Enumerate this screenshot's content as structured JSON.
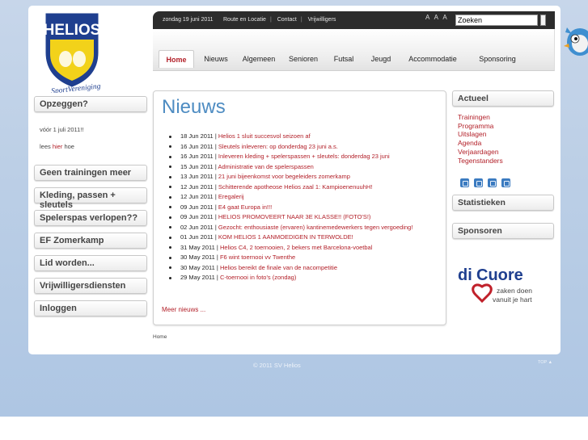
{
  "topbar": {
    "date": "zondag 19 juni 2011",
    "links": [
      "Route en Locatie",
      "Contact",
      "Vrijwilligers"
    ],
    "font_sizes": "A A A",
    "search_value": "Zoeken"
  },
  "logo": {
    "name": "HELIOS",
    "tagline": "SportVereniging"
  },
  "nav": {
    "tabs": [
      "Home",
      "Nieuws",
      "Algemeen",
      "Senioren",
      "Futsal",
      "Jeugd",
      "Accommodatie",
      "Sponsoring"
    ],
    "active": "Home"
  },
  "sidebar_left": {
    "opzeggen": {
      "title": "Opzeggen?",
      "text1": "vóór 1 juli 2011!!",
      "text2_prefix": "lees ",
      "text2_link": "hier",
      "text2_suffix": " hoe"
    },
    "items": [
      "Geen trainingen meer",
      "Kleding, passen + sleutels",
      "Spelerspas verlopen??",
      "EF Zomerkamp",
      "Lid worden...",
      "Vrijwilligersdiensten",
      "Inloggen"
    ]
  },
  "main": {
    "title": "Nieuws",
    "news": [
      {
        "date": "18 Jun 2011 |",
        "title": "Helios 1 sluit succesvol seizoen af"
      },
      {
        "date": "16 Jun 2011 |",
        "title": "Sleutels inleveren: op donderdag 23 juni a.s."
      },
      {
        "date": "16 Jun 2011 |",
        "title": "Inleveren kleding + spelerspassen + sleutels: donderdag 23 juni"
      },
      {
        "date": "15 Jun 2011 |",
        "title": "Administratie van de spelerspassen"
      },
      {
        "date": "13 Jun 2011 |",
        "title": "21 juni bijeenkomst voor begeleiders zomerkamp"
      },
      {
        "date": "12 Jun 2011 |",
        "title": "Schitterende apotheose Helios zaal 1: KampioenenuuhH!"
      },
      {
        "date": "12 Jun 2011 |",
        "title": "Eregalerij"
      },
      {
        "date": "09 Jun 2011 |",
        "title": "E4 gaat Europa in!!!"
      },
      {
        "date": "09 Jun 2011 |",
        "title": "HELIOS PROMOVEERT NAAR 3E KLASSE!! (FOTO'S!)"
      },
      {
        "date": "02 Jun 2011 |",
        "title": "Gezocht: enthousiaste (ervaren) kantinemedewerkers tegen vergoeding!"
      },
      {
        "date": "01 Jun 2011 |",
        "title": "KOM HELIOS 1 AANMOEDIGEN IN TERWOLDE!"
      },
      {
        "date": "31 May 2011 |",
        "title": "Helios C4, 2 toernooien, 2 bekers met Barcelona-voetbal"
      },
      {
        "date": "30 May 2011 |",
        "title": "F6 wint toernooi vv Twenthe"
      },
      {
        "date": "30 May 2011 |",
        "title": "Helios bereikt de finale van de nacompetitie"
      },
      {
        "date": "29 May 2011 |",
        "title": "C-toernooi in foto's (zondag)"
      }
    ],
    "more": "Meer nieuws ..."
  },
  "breadcrumb": "Home",
  "sidebar_right": {
    "actueel_title": "Actueel",
    "actueel_links": [
      "Trainingen",
      "Programma",
      "Uitslagen",
      "Agenda",
      "Verjaardagen",
      "Tegenstanders"
    ],
    "social_icons": [
      "rss-icon",
      "chart-icon",
      "camera-icon",
      "email-icon"
    ],
    "statistieken_title": "Statistieken",
    "sponsoren_title": "Sponsoren",
    "sponsor": {
      "name_a": "di",
      "name_b": "Cuore",
      "line1": "zaken doen",
      "line2": "vanuit je hart"
    }
  },
  "footer": {
    "copyright": "© 2011 SV Helios",
    "top": "TOP"
  },
  "colors": {
    "accent_red": "#b21f28",
    "title_blue": "#4e8cc2",
    "topbar": "#2c2c2c",
    "background": "#bccfe6"
  }
}
